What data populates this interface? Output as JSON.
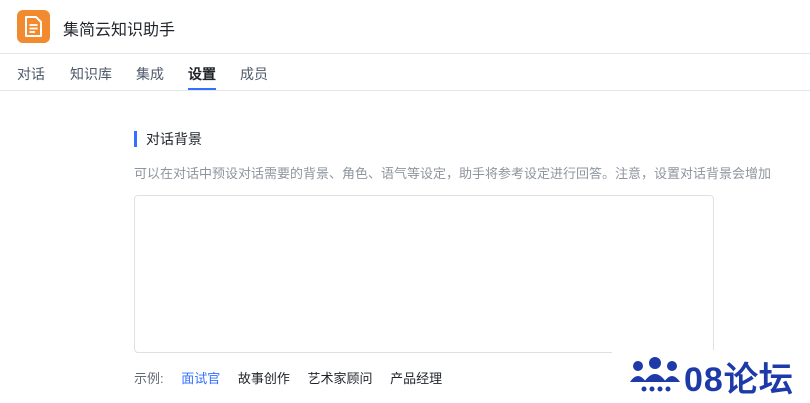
{
  "app": {
    "title": "集简云知识助手",
    "icon": "document-icon",
    "icon_color": "#f28b30"
  },
  "tabs": [
    {
      "label": "对话",
      "active": false
    },
    {
      "label": "知识库",
      "active": false
    },
    {
      "label": "集成",
      "active": false
    },
    {
      "label": "设置",
      "active": true
    },
    {
      "label": "成员",
      "active": false
    }
  ],
  "settings": {
    "section_title": "对话背景",
    "description": "可以在对话中预设对话需要的背景、角色、语气等设定，助手将参考设定进行回答。注意，设置对话背景会增加",
    "textarea_value": "",
    "examples_label": "示例:",
    "examples": [
      {
        "label": "面试官",
        "active": true
      },
      {
        "label": "故事创作",
        "active": false
      },
      {
        "label": "艺术家顾问",
        "active": false
      },
      {
        "label": "产品经理",
        "active": false
      }
    ]
  },
  "watermark": {
    "text": "08论坛",
    "icon": "users-group-icon",
    "color": "#1d3aa8"
  },
  "colors": {
    "accent": "#3370ff",
    "border": "#e5e6eb"
  }
}
